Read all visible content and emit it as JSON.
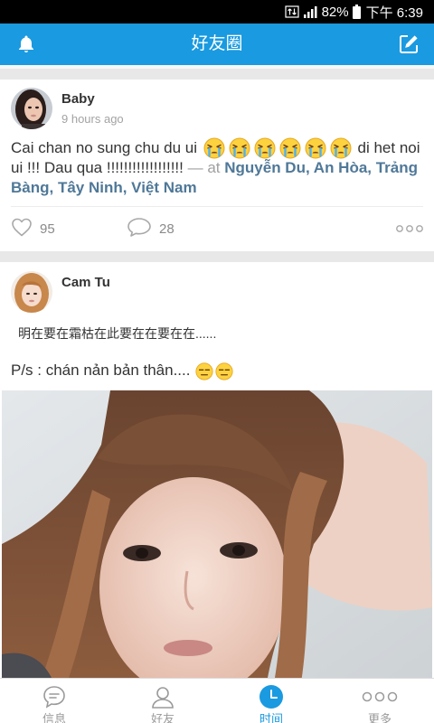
{
  "status_bar": {
    "battery_percent": "82%",
    "time": "下午 6:39"
  },
  "header": {
    "title": "好友圈",
    "left_icon": "bell-icon",
    "right_icon": "edit-icon"
  },
  "posts": [
    {
      "author": "Baby",
      "time_ago": "9 hours ago",
      "text_before_emoji": "Cai chan no sung chu du ui",
      "emoji_icons": [
        "crying-face-icon",
        "crying-face-icon",
        "crying-face-icon",
        "crying-face-icon",
        "crying-face-icon",
        "crying-face-icon"
      ],
      "text_after_emoji": "di het noi ui !!! Dau qua !!!!!!!!!!!!!!!!!!",
      "location_prefix": "— at",
      "location": "Nguyễn Du, An Hòa, Trảng Bàng, Tây Ninh, Việt Nam",
      "likes": "95",
      "comments": "28"
    },
    {
      "author": "Cam Tu",
      "text_line_1": "明在要在霜枯在此要在在要在在......",
      "text_line_2": "P/s : chán nản bản thân....",
      "emoji_icons": [
        "expressionless-face-icon",
        "expressionless-face-icon"
      ]
    }
  ],
  "bottom_nav": {
    "items": [
      {
        "label": "信息",
        "icon": "message-icon",
        "active": false
      },
      {
        "label": "好友",
        "icon": "friends-icon",
        "active": false
      },
      {
        "label": "时间",
        "icon": "clock-icon",
        "active": true
      },
      {
        "label": "更多",
        "icon": "more-icon",
        "active": false
      }
    ]
  },
  "colors": {
    "accent": "#1a9ae0",
    "location": "#4f7898"
  }
}
